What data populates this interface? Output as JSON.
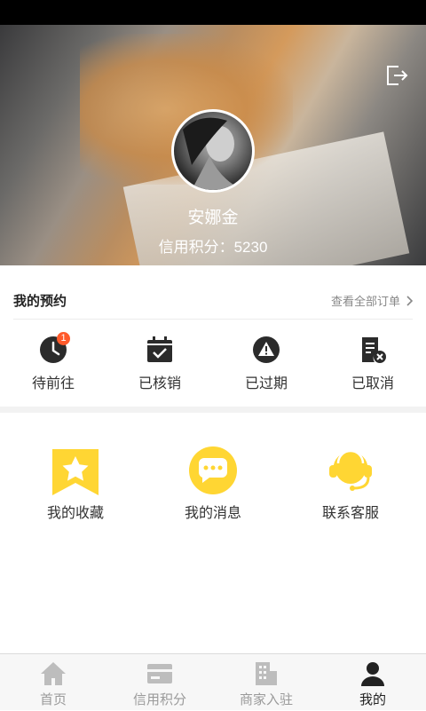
{
  "profile": {
    "name": "安娜金",
    "credit_label": "信用积分：",
    "credit_value": "5230"
  },
  "orders": {
    "title": "我的预约",
    "view_all": "查看全部订单",
    "statuses": [
      {
        "label": "待前往",
        "icon": "clock-icon",
        "badge": "1"
      },
      {
        "label": "已核销",
        "icon": "calendar-check-icon"
      },
      {
        "label": "已过期",
        "icon": "warning-icon"
      },
      {
        "label": "已取消",
        "icon": "document-cancel-icon"
      }
    ]
  },
  "services": [
    {
      "label": "我的收藏",
      "icon": "star-bookmark-icon"
    },
    {
      "label": "我的消息",
      "icon": "chat-bubble-icon"
    },
    {
      "label": "联系客服",
      "icon": "headset-icon"
    }
  ],
  "tabs": [
    {
      "label": "首页",
      "icon": "home-icon"
    },
    {
      "label": "信用积分",
      "icon": "card-icon"
    },
    {
      "label": "商家入驻",
      "icon": "building-icon"
    },
    {
      "label": "我的",
      "icon": "person-icon",
      "active": true
    }
  ],
  "colors": {
    "accent": "#ffd633",
    "badge": "#ff5a2b",
    "icon_dark": "#2b2b2b",
    "tab_inactive": "#9a9a9a"
  }
}
